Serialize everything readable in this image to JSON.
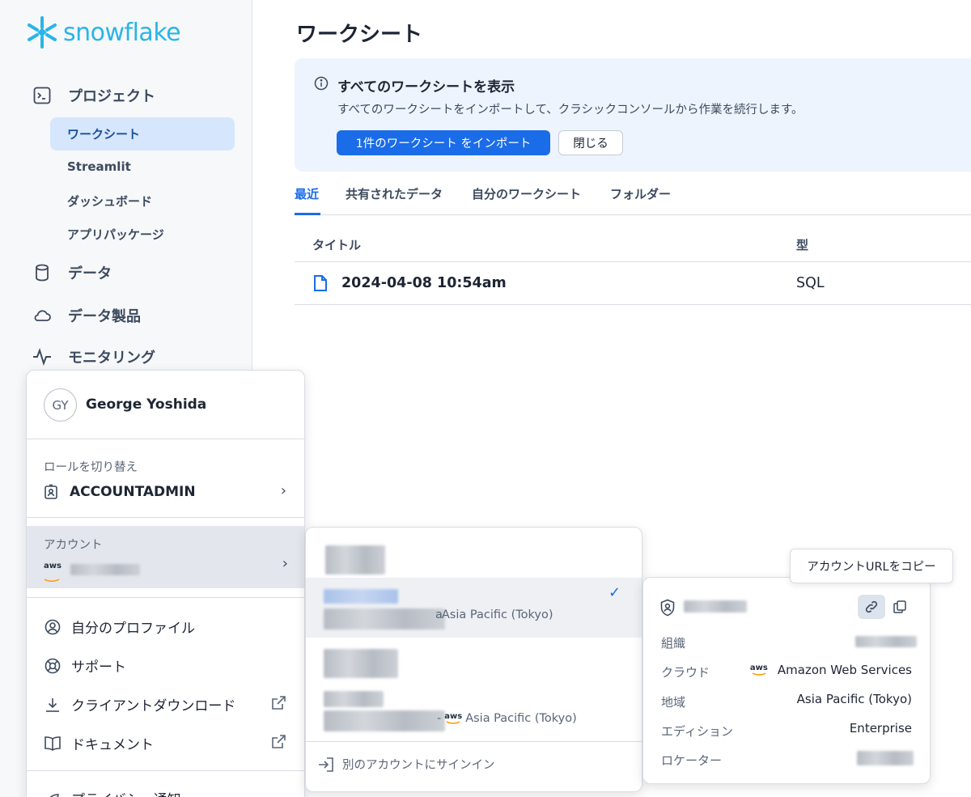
{
  "app": {
    "brand": "snowflake",
    "brand_color": "#29b5e8",
    "accent_color": "#1a6ce8"
  },
  "sidebar": {
    "items": [
      {
        "label": "プロジェクト",
        "icon": "terminal-icon"
      },
      {
        "label": "データ",
        "icon": "database-icon"
      },
      {
        "label": "データ製品",
        "icon": "cloud-icon"
      },
      {
        "label": "モニタリング",
        "icon": "activity-icon"
      }
    ],
    "sub_items": [
      "ワークシート",
      "Streamlit",
      "ダッシュボード",
      "アプリパッケージ"
    ],
    "active_sub_item": "ワークシート"
  },
  "main": {
    "title": "ワークシート",
    "banner": {
      "title": "すべてのワークシートを表示",
      "description": "すべてのワークシートをインポートして、クラシックコンソールから作業を続行します。",
      "import_button": "1件のワークシート をインポート",
      "close_button": "閉じる"
    },
    "tabs": [
      "最近",
      "共有されたデータ",
      "自分のワークシート",
      "フォルダー"
    ],
    "active_tab": "最近",
    "table": {
      "columns": [
        "タイトル",
        "型"
      ],
      "rows": [
        {
          "title": "2024-04-08 10:54am",
          "type": "SQL"
        }
      ]
    }
  },
  "user_menu": {
    "initials": "GY",
    "name": "George Yoshida",
    "role_label": "ロールを切り替え",
    "role": "ACCOUNTADMIN",
    "account_label": "アカウント",
    "account_cloud": "aws",
    "items": [
      {
        "label": "自分のプロファイル",
        "icon": "user-circle-icon"
      },
      {
        "label": "サポート",
        "icon": "lifebuoy-icon"
      },
      {
        "label": "クライアントダウンロード",
        "icon": "download-icon"
      },
      {
        "label": "ドキュメント",
        "icon": "book-icon"
      },
      {
        "label": "プライバシー通知",
        "icon": "privacy-icon"
      }
    ]
  },
  "accounts_menu": {
    "accounts": [
      {
        "region": "Asia Pacific (Tokyo)",
        "region_prefix": "a",
        "selected": true
      },
      {
        "region": "Asia Pacific (Tokyo)",
        "region_prefix": "-",
        "cloud": "aws",
        "selected": false
      }
    ],
    "signin_label": "別のアカウントにサインイン"
  },
  "account_details": {
    "tooltip": "アカウントURLをコピー",
    "fields": [
      {
        "label": "組織",
        "value": ""
      },
      {
        "label": "クラウド",
        "value": "Amazon Web Services",
        "cloud": "aws"
      },
      {
        "label": "地域",
        "value": "Asia Pacific (Tokyo)"
      },
      {
        "label": "エディション",
        "value": "Enterprise"
      },
      {
        "label": "ロケーター",
        "value": ""
      }
    ]
  }
}
